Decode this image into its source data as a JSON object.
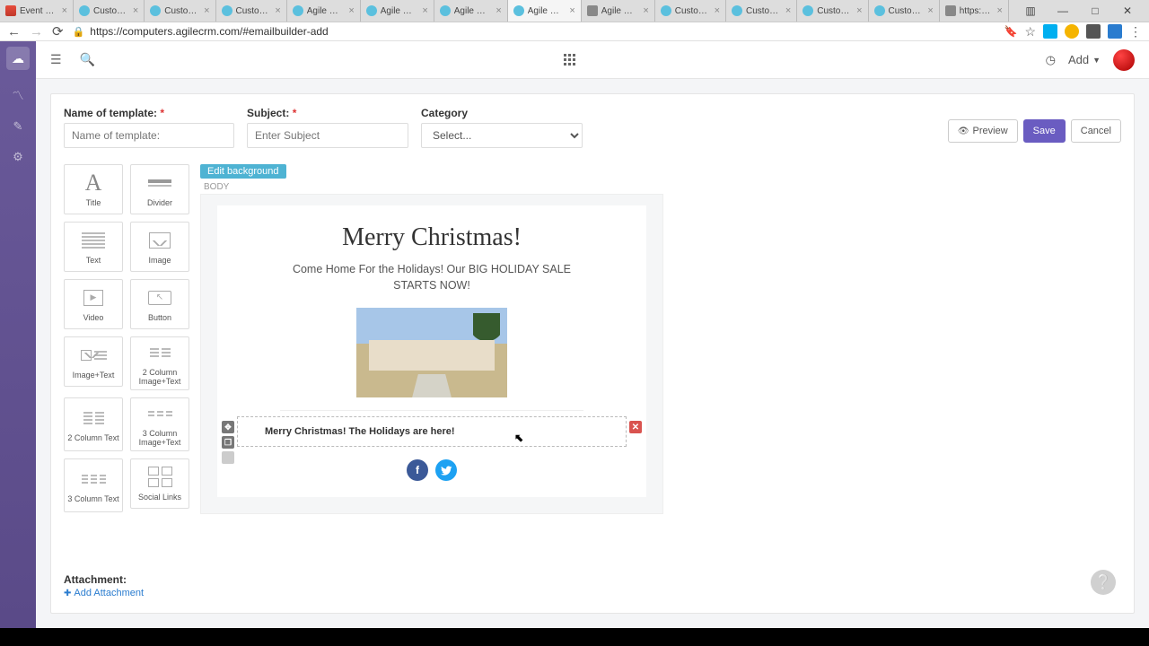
{
  "browser": {
    "tabs": [
      {
        "label": "Event Rem",
        "fav": "fav-gmail"
      },
      {
        "label": "Customer",
        "fav": "fav-agile"
      },
      {
        "label": "Customer",
        "fav": "fav-agile"
      },
      {
        "label": "Customer",
        "fav": "fav-agile"
      },
      {
        "label": "Agile CRM",
        "fav": "fav-agile"
      },
      {
        "label": "Agile CRM",
        "fav": "fav-agile"
      },
      {
        "label": "Agile CRM",
        "fav": "fav-agile"
      },
      {
        "label": "Agile CRM",
        "fav": "fav-agile",
        "active": true
      },
      {
        "label": "Agile CRM",
        "fav": "fav-gen"
      },
      {
        "label": "Customer",
        "fav": "fav-agile"
      },
      {
        "label": "Customer",
        "fav": "fav-agile"
      },
      {
        "label": "Customer",
        "fav": "fav-agile"
      },
      {
        "label": "Customer",
        "fav": "fav-agile"
      },
      {
        "label": "https://ou",
        "fav": "fav-gen"
      }
    ],
    "url": "https://computers.agilecrm.com/#emailbuilder-add"
  },
  "topbar": {
    "add_label": "Add"
  },
  "form": {
    "name_label": "Name of template:",
    "name_placeholder": "Name of template:",
    "subject_label": "Subject:",
    "subject_placeholder": "Enter Subject",
    "category_label": "Category",
    "category_selected": "Select...",
    "preview_label": "Preview",
    "save_label": "Save",
    "cancel_label": "Cancel"
  },
  "palette": {
    "items": [
      "Title",
      "Divider",
      "Text",
      "Image",
      "Video",
      "Button",
      "Image+Text",
      "2 Column Image+Text",
      "2 Column Text",
      "3 Column Image+Text",
      "3 Column Text",
      "Social Links"
    ]
  },
  "canvas": {
    "edit_bg": "Edit background",
    "body_label": "BODY",
    "title": "Merry Christmas!",
    "sub": "Come Home For the Holidays!  Our BIG HOLIDAY SALE STARTS NOW!",
    "text_block": "Merry Christmas!  The Holidays are here!"
  },
  "attachment": {
    "label": "Attachment:",
    "add": "Add Attachment"
  }
}
